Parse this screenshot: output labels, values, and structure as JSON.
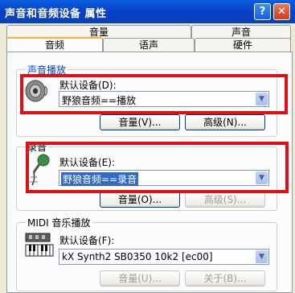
{
  "window": {
    "title": "声音和音频设备 属性",
    "help_label": "?",
    "close_label": "✕"
  },
  "tabs_back": [
    "音量",
    "声音"
  ],
  "tabs_front": [
    "音频",
    "语声",
    "硬件"
  ],
  "playback": {
    "group_label": "声音播放",
    "field_label": "默认设备(D):",
    "value": "野狼音频==播放",
    "volume_btn": "音量(V)...",
    "advanced_btn": "高级(N)..."
  },
  "recording": {
    "group_label": "录音",
    "field_label": "默认设备(E):",
    "value": "野狼音频==录音",
    "volume_btn": "音量(O)...",
    "advanced_btn": "高级(S)..."
  },
  "midi": {
    "group_label": "MIDI 音乐播放",
    "field_label": "默认设备(F):",
    "value": "kX Synth2 SB0350 10k2 [ec00]",
    "volume_btn": "音量(U)...",
    "about_btn": "关于(B)..."
  },
  "colors": {
    "highlight_box": "#E01010",
    "titlebar": "#0A3FC8"
  }
}
